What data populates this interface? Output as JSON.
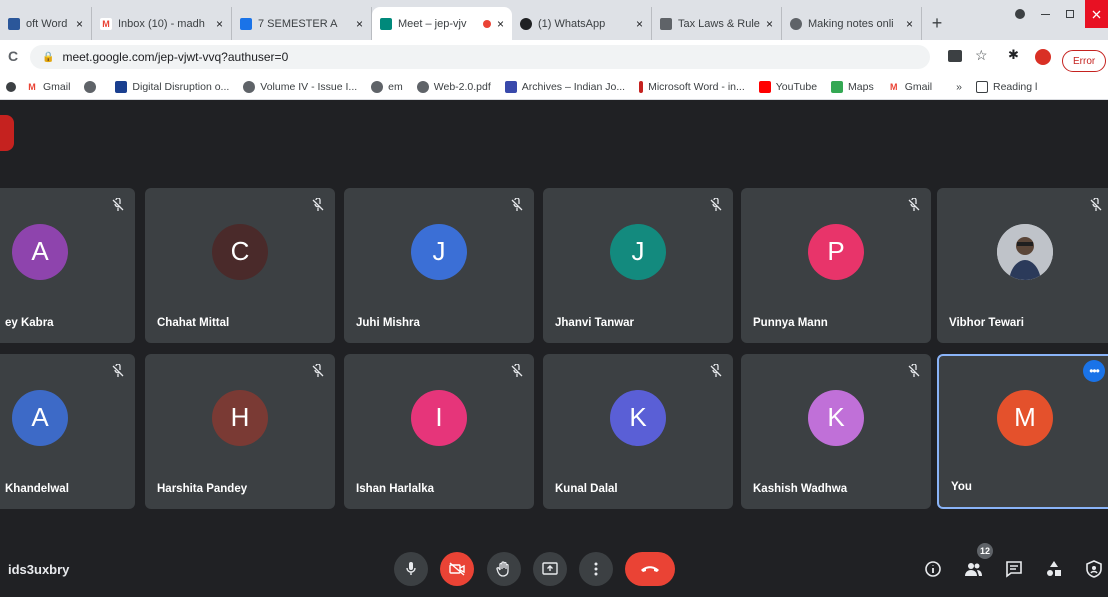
{
  "browser": {
    "tabs": [
      {
        "label": "oft Word - ",
        "fav_color": "#2b579a",
        "fav_glyph": "",
        "active": false
      },
      {
        "label": "Inbox (10) - madh",
        "fav_color": "#ffffff",
        "fav_glyph": "M",
        "active": false
      },
      {
        "label": "7 SEMESTER A",
        "fav_color": "#1a73e8",
        "fav_glyph": "",
        "active": false
      },
      {
        "label": "Meet – jep-vjv",
        "fav_color": "#00897b",
        "fav_glyph": "",
        "active": true
      },
      {
        "label": "(1) WhatsApp",
        "fav_color": "#202124",
        "fav_glyph": "",
        "active": false
      },
      {
        "label": "Tax Laws & Rules",
        "fav_color": "#5f6368",
        "fav_glyph": "",
        "active": false
      },
      {
        "label": "Making notes onli",
        "fav_color": "#5f6368",
        "fav_glyph": "",
        "active": false
      }
    ],
    "tab_close_glyph": "×",
    "new_tab_glyph": "+",
    "url": "meet.google.com/jep-vjwt-vvq?authuser=0",
    "error_label": "Error",
    "bookmarks": [
      {
        "label": "Gmail",
        "color": "#ea4335",
        "glyph": "M"
      },
      {
        "label": "",
        "color": "#5f6368",
        "glyph": ""
      },
      {
        "label": "Digital Disruption o...",
        "color": "#1a3f8f",
        "glyph": ""
      },
      {
        "label": "Volume IV - Issue I...",
        "color": "#5f6368",
        "glyph": ""
      },
      {
        "label": "em",
        "color": "#5f6368",
        "glyph": ""
      },
      {
        "label": "Web-2.0.pdf",
        "color": "#5f6368",
        "glyph": ""
      },
      {
        "label": "Archives – Indian Jo...",
        "color": "#3949ab",
        "glyph": ""
      },
      {
        "label": "Microsoft Word - in...",
        "color": "#c5221f",
        "glyph": ""
      },
      {
        "label": "YouTube",
        "color": "#ff0000",
        "glyph": ""
      },
      {
        "label": "Maps",
        "color": "#34a853",
        "glyph": ""
      },
      {
        "label": "Gmail",
        "color": "#ea4335",
        "glyph": "M"
      }
    ],
    "bookmarks_overflow": "»",
    "reading_list": "Reading l"
  },
  "meet": {
    "meeting_code": "ids3uxbry",
    "participant_count": "12",
    "row1": [
      {
        "name": "ey Kabra",
        "initial": "A",
        "color": "#8e44ad",
        "photo": false
      },
      {
        "name": "Chahat Mittal",
        "initial": "C",
        "color": "#4a2a2a",
        "photo": false
      },
      {
        "name": "Juhi Mishra",
        "initial": "J",
        "color": "#3b6fd6",
        "photo": false
      },
      {
        "name": "Jhanvi Tanwar",
        "initial": "J",
        "color": "#138a7e",
        "photo": false
      },
      {
        "name": "Punnya Mann",
        "initial": "P",
        "color": "#e8346a",
        "photo": false
      },
      {
        "name": "Vibhor Tewari",
        "initial": "",
        "color": "#c9ccd1",
        "photo": true
      }
    ],
    "row2": [
      {
        "name": "Khandelwal",
        "initial": "A",
        "color": "#3d6ac7",
        "photo": false
      },
      {
        "name": "Harshita Pandey",
        "initial": "H",
        "color": "#7a3a34",
        "photo": false
      },
      {
        "name": "Ishan Harlalka",
        "initial": "I",
        "color": "#e6357a",
        "photo": false
      },
      {
        "name": "Kunal Dalal",
        "initial": "K",
        "color": "#5a5fd6",
        "photo": false
      },
      {
        "name": "Kashish Wadhwa",
        "initial": "K",
        "color": "#c070d8",
        "photo": false
      },
      {
        "name": "You",
        "initial": "M",
        "color": "#e4512c",
        "photo": false
      }
    ]
  }
}
